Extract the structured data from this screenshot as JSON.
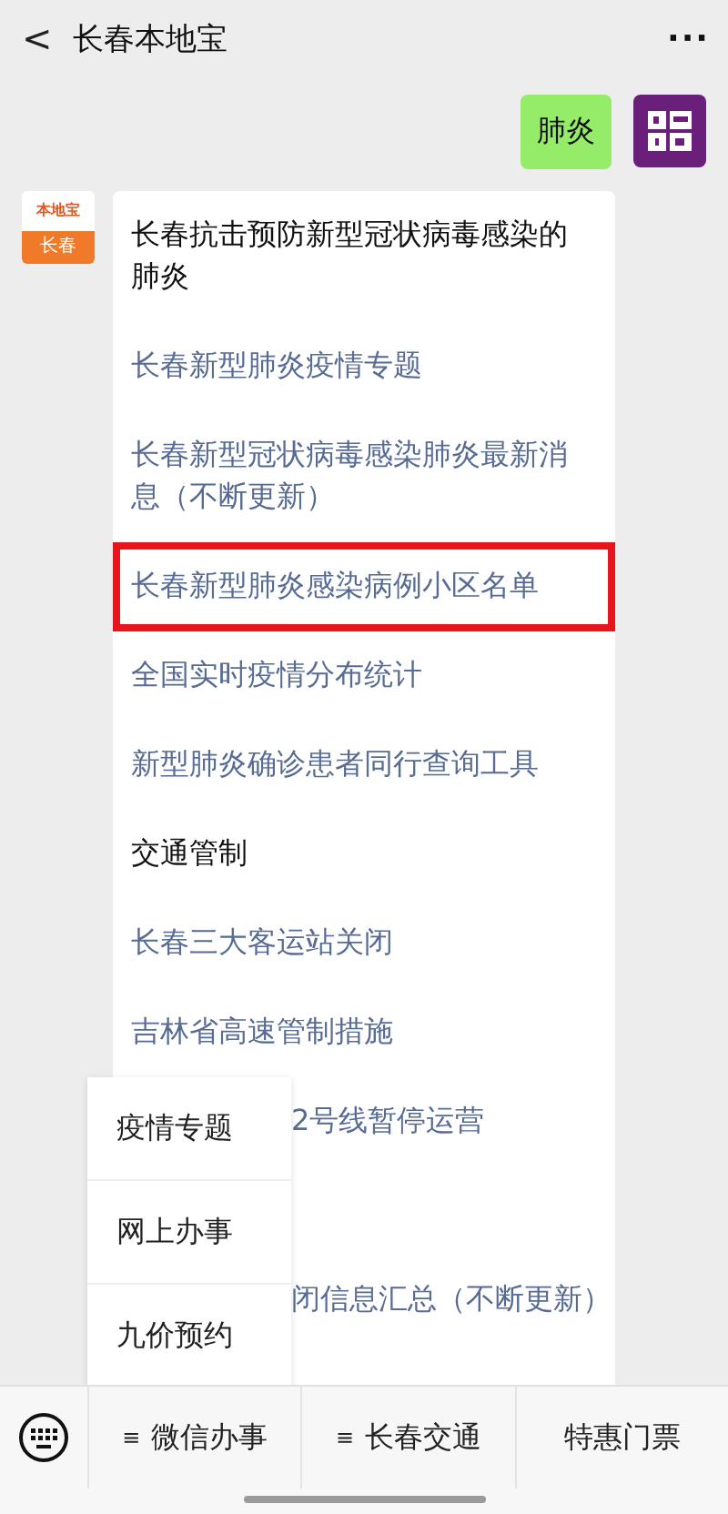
{
  "header": {
    "back": "<",
    "title": "长春本地宝",
    "more": "···"
  },
  "sent": {
    "text": "肺炎"
  },
  "reply": {
    "avatar_top": "本地宝",
    "avatar_bottom": "长春",
    "items": [
      {
        "kind": "heading",
        "text": "长春抗击预防新型冠状病毒感染的肺炎",
        "highlighted": false
      },
      {
        "kind": "link",
        "text": "长春新型肺炎疫情专题",
        "highlighted": false
      },
      {
        "kind": "link",
        "text": "长春新型冠状病毒感染肺炎最新消息（不断更新）",
        "highlighted": false
      },
      {
        "kind": "link",
        "text": "长春新型肺炎感染病例小区名单",
        "highlighted": true
      },
      {
        "kind": "link",
        "text": "全国实时疫情分布统计",
        "highlighted": false
      },
      {
        "kind": "link",
        "text": "新型肺炎确诊患者同行查询工具",
        "highlighted": false
      },
      {
        "kind": "heading",
        "text": "交通管制",
        "highlighted": false
      },
      {
        "kind": "link",
        "text": "长春三大客运站关闭",
        "highlighted": false
      },
      {
        "kind": "link",
        "text": "吉林省高速管制措施",
        "highlighted": false
      },
      {
        "kind": "clipped-link",
        "text": "2号线暂停运营",
        "highlighted": false
      },
      {
        "kind": "clipped-link",
        "text": "闭信息汇总（不断更新）",
        "highlighted": false
      }
    ]
  },
  "popup_menu": {
    "items": [
      "疫情专题",
      "网上办事",
      "九价预约"
    ]
  },
  "bottom_menu": {
    "items": [
      {
        "text": "微信办事",
        "has_submenu": true
      },
      {
        "text": "长春交通",
        "has_submenu": true
      },
      {
        "text": "特惠门票",
        "has_submenu": false
      }
    ],
    "submenu_mark": "≡"
  }
}
